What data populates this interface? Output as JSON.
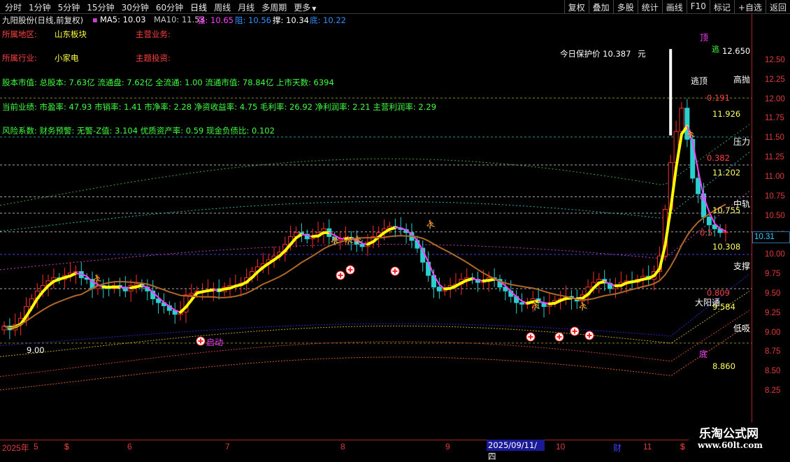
{
  "toolbar": {
    "left": [
      "分时",
      "1分钟",
      "5分钟",
      "15分钟",
      "30分钟",
      "60分钟",
      "日线",
      "周线",
      "月线",
      "多周期",
      "更多"
    ],
    "more_arrow": "▼",
    "right": [
      "复权",
      "叠加",
      "多股",
      "统计",
      "画线",
      "F10",
      "标记",
      "+自选",
      "返回"
    ]
  },
  "title": {
    "stock": "九阳股份(日线,前复权)",
    "ma5": "MA5: 10.03",
    "ma10": "MA10: 11.53",
    "qiang": "强: 10.65",
    "zu": "阻: 10.56",
    "cheng": "撑: 10.34",
    "di": "底: 10.22"
  },
  "info": {
    "region_label": "所属地区:",
    "region_value": "山东板块",
    "business_label": "主营业务:",
    "industry_label": "所属行业:",
    "industry_value": "小家电",
    "investment_label": "主题投资:",
    "line1": "股本市值: 总股本: 7.63亿 流通盘: 7.62亿 全流通: 1.00 流通市值: 78.84亿 上市天数: 6394",
    "line2": "当前业绩: 市盈率: 47.93 市销率: 1.41 市净率: 2.28 净资收益率: 4.75 毛利率: 26.92 净利润率: 2.21 主营利润率: 2.29",
    "line3": "风险系数: 财务预警: 无警-Z值: 3.104 优质资产率: 0.59 现金负债比: 0.102"
  },
  "protect": {
    "label": "今日保护价",
    "value": "10.387",
    "unit": "元"
  },
  "price_box": "10.31",
  "bottom": {
    "year_label": "2025年",
    "months": [
      "5",
      "6",
      "7",
      "8",
      "9",
      "10",
      "11"
    ],
    "cursor_date": "2025/09/11/四",
    "marks": [
      "$",
      "财",
      "$"
    ]
  },
  "watermark": {
    "line1": "乐淘公式网",
    "line2": "www.60lt.com"
  },
  "right_labels": {
    "ding": "顶",
    "tao": "逃",
    "taoding": "逃顶",
    "gaopao": "高抛",
    "yali": "压力",
    "zhonggui": "中轨",
    "zhong": "中",
    "zhicheng": "支撑",
    "dayangtong": "大阳通",
    "dixi": "低吸",
    "di": "底",
    "qidong": "启动"
  },
  "chart_data": {
    "type": "candlestick",
    "ylim": [
      8.1,
      12.68
    ],
    "yticks": [
      "12.50",
      "12.25",
      "12.00",
      "11.75",
      "11.50",
      "11.25",
      "11.00",
      "10.75",
      "10.50",
      "10.25",
      "10.00",
      "9.75",
      "9.50",
      "9.25",
      "9.00",
      "8.75",
      "8.50",
      "8.25"
    ],
    "annotations": [
      "12.650",
      "0.191",
      "11.926",
      "0.382",
      "11.202",
      "10.755",
      "0.5",
      "10.308",
      "0.809",
      "9.584",
      "8.860",
      "9.00"
    ],
    "levels": [
      {
        "name": "高抛",
        "value": 12.0,
        "color": "#b0b020"
      },
      {
        "name": "压力",
        "value": 11.55,
        "color": "#30c0c0"
      },
      {
        "name": "中轨",
        "value": 11.0,
        "color": "#b0b020"
      },
      {
        "name": "支撑",
        "value": 10.05,
        "color": "#6060ff"
      },
      {
        "name": "低吸",
        "value": 9.33,
        "color": "#c08020"
      },
      {
        "name": "底",
        "value": 8.86,
        "color": "#b0b020"
      }
    ],
    "closes": [
      9.1,
      9.05,
      9.12,
      9.2,
      9.35,
      9.45,
      9.55,
      9.62,
      9.68,
      9.72,
      9.7,
      9.75,
      9.78,
      9.8,
      9.72,
      9.7,
      9.58,
      9.62,
      9.6,
      9.58,
      9.62,
      9.6,
      9.55,
      9.62,
      9.64,
      9.6,
      9.55,
      9.45,
      9.4,
      9.36,
      9.3,
      9.25,
      9.28,
      9.5,
      9.52,
      9.55,
      9.55,
      9.56,
      9.58,
      9.54,
      9.6,
      9.62,
      9.62,
      9.65,
      9.72,
      9.8,
      9.86,
      9.9,
      9.95,
      10.0,
      10.05,
      10.15,
      10.25,
      10.3,
      10.28,
      10.22,
      10.25,
      10.3,
      10.35,
      10.25,
      10.2,
      10.22,
      10.24,
      10.21,
      10.15,
      10.12,
      10.18,
      10.25,
      10.3,
      10.35,
      10.38,
      10.36,
      10.34,
      10.3,
      10.2,
      10.1,
      9.92,
      9.75,
      9.6,
      9.55,
      9.58,
      9.62,
      9.64,
      9.7,
      9.72,
      9.7,
      9.66,
      9.68,
      9.72,
      9.7,
      9.6,
      9.55,
      9.48,
      9.4,
      9.38,
      9.4,
      9.45,
      9.4,
      9.35,
      9.4,
      9.43,
      9.45,
      9.48,
      9.45,
      9.42,
      9.5,
      9.6,
      9.66,
      9.7,
      9.65,
      9.58,
      9.62,
      9.66,
      9.68,
      9.66,
      9.7,
      9.74,
      9.7,
      9.8,
      10.0,
      10.6,
      11.2,
      11.6,
      11.9,
      11.5,
      11.0,
      10.8,
      10.5,
      10.4,
      10.35,
      10.3,
      10.31
    ],
    "ma_brown_x": [
      0,
      130
    ],
    "markers_plus": [
      [
        287,
        488
      ],
      [
        487,
        394
      ],
      [
        501,
        386
      ],
      [
        565,
        388
      ],
      [
        759,
        482
      ],
      [
        800,
        482
      ],
      [
        822,
        474
      ],
      [
        843,
        480
      ]
    ]
  }
}
